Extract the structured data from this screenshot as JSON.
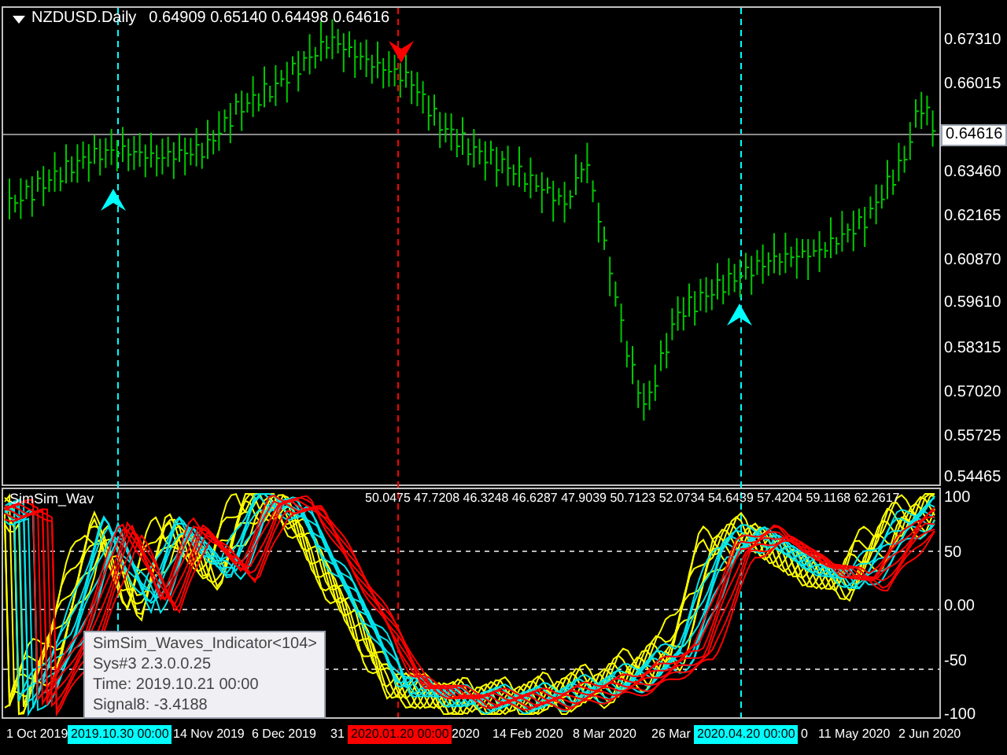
{
  "chart": {
    "symbol": "NZDUSD.Daily",
    "ohlc": "0.64909 0.65140 0.64498 0.64616",
    "price_axis": [
      "0.67310",
      "0.66015",
      "0.63460",
      "0.62165",
      "0.60870",
      "0.59610",
      "0.58315",
      "0.57020",
      "0.55725",
      "0.54465"
    ],
    "current_price": "0.64616"
  },
  "indicator": {
    "label": "SimSim_Wav",
    "values": "50.0475 47.7208 46.3248 46.6287 47.9039 50.7123 52.0734 54.6439 57.4204 59.1168 62.2617",
    "axis": [
      "100",
      "50",
      "0.00",
      "-50",
      "-100"
    ]
  },
  "tooltip": {
    "lines": [
      "SimSim_Waves_Indicator<104>",
      "Sys#3 2.3.0.0.25",
      "Time: 2019.10.21 00:00",
      "Signal8: -3.4188"
    ]
  },
  "time_axis": [
    {
      "label": "1 Oct 2019",
      "kind": "date"
    },
    {
      "label": "2019.10.30 00:00",
      "kind": "marker",
      "color": "#00ffff"
    },
    {
      "label": "14 Nov 2019",
      "kind": "date"
    },
    {
      "label": "6 Dec 2019",
      "kind": "date"
    },
    {
      "label": "31",
      "kind": "date"
    },
    {
      "label": "2020.01.20 00:00",
      "kind": "marker",
      "color": "#ff0000"
    },
    {
      "label": "2020",
      "kind": "date"
    },
    {
      "label": "14 Feb 2020",
      "kind": "date"
    },
    {
      "label": "8 Mar 2020",
      "kind": "date"
    },
    {
      "label": "26 Mar",
      "kind": "date"
    },
    {
      "label": "2020.04.20 00:00",
      "kind": "marker",
      "color": "#00ffff"
    },
    {
      "label": "0",
      "kind": "date"
    },
    {
      "label": "11 May 2020",
      "kind": "date"
    },
    {
      "label": "2 Jun 2020",
      "kind": "date"
    }
  ]
}
